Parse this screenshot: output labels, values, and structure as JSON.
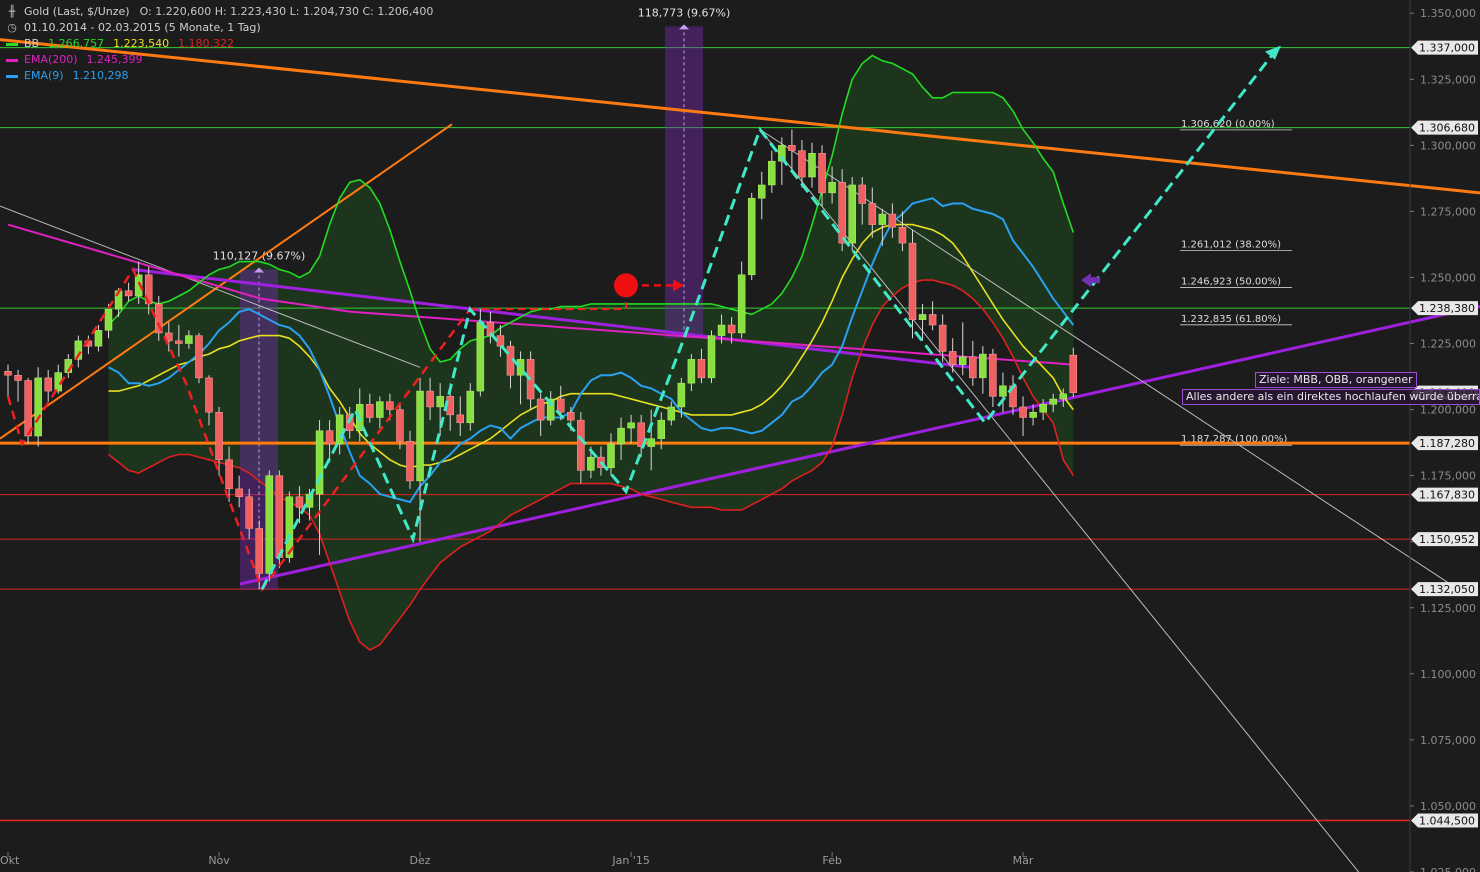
{
  "header": {
    "title": "Gold (Last, $/Unze)",
    "ohlc": "O: 1.220,600  H: 1.223,430  L: 1.204,730  C: 1.206,400",
    "range": "01.10.2014 - 02.03.2015 (5 Monate, 1 Tag)",
    "indicators": [
      {
        "name": "BB",
        "values": [
          "1.266,757",
          "1.223,540",
          "1.180,322"
        ],
        "colors": [
          "#22dd22",
          "#e8e020",
          "#e02020"
        ]
      },
      {
        "name": "EMA(200)",
        "values": [
          "1.245,399"
        ],
        "colors": [
          "#e020c0"
        ]
      },
      {
        "name": "EMA(9)",
        "values": [
          "1.210,298"
        ],
        "colors": [
          "#2aa0f0"
        ]
      }
    ]
  },
  "annotations": {
    "target_note": "Ziele: MBB, OBB, orangener",
    "warning_note": "Alles andere als ein direktes hochlaufen würde überra",
    "range_label_1": "110,127 (9.67%)",
    "range_label_2": "118,773 (9.67%)"
  },
  "chart_data": {
    "type": "candlestick",
    "title": "Gold (Last, $/Unze)",
    "x_axis": {
      "ticks": [
        "Okt",
        "Nov",
        "Dez",
        "Jan '15",
        "Feb",
        "Mär"
      ]
    },
    "y_axis": {
      "min": 1025,
      "max": 1355,
      "ticks": [
        1025,
        1050,
        1075,
        1100,
        1125,
        1150,
        1175,
        1200,
        1225,
        1250,
        1275,
        1300,
        1325,
        1350
      ],
      "tick_labels": [
        "1.025,000",
        "1.050,000",
        "1.075,000",
        "1.100,000",
        "1.125,000",
        "1.150,000",
        "1.175,000",
        "1.200,000",
        "1.225,000",
        "1.250,000",
        "1.275,000",
        "1.300,000",
        "1.325,000",
        "1.350,000"
      ]
    },
    "bars": [
      [
        1214.5,
        1217,
        1205,
        1213
      ],
      [
        1213,
        1215,
        1203,
        1211
      ],
      [
        1211,
        1212,
        1187,
        1190
      ],
      [
        1190,
        1216,
        1186,
        1212
      ],
      [
        1212,
        1215,
        1203,
        1207
      ],
      [
        1207,
        1217,
        1206,
        1214
      ],
      [
        1214,
        1221,
        1212,
        1219
      ],
      [
        1219,
        1228,
        1216,
        1226
      ],
      [
        1226,
        1228,
        1221,
        1224
      ],
      [
        1224,
        1232,
        1222,
        1230
      ],
      [
        1230,
        1240,
        1227,
        1238
      ],
      [
        1238,
        1246,
        1235,
        1245
      ],
      [
        1245,
        1248,
        1241,
        1243
      ],
      [
        1243,
        1256,
        1240,
        1251
      ],
      [
        1251,
        1254,
        1236,
        1240
      ],
      [
        1240,
        1243,
        1226,
        1229
      ],
      [
        1229,
        1233,
        1222,
        1226
      ],
      [
        1226,
        1232,
        1220,
        1225
      ],
      [
        1225,
        1230,
        1223,
        1228
      ],
      [
        1228,
        1229,
        1210,
        1212
      ],
      [
        1212,
        1213,
        1194,
        1199
      ],
      [
        1199,
        1201,
        1175,
        1181
      ],
      [
        1181,
        1186,
        1165,
        1170
      ],
      [
        1170,
        1175,
        1163,
        1167
      ],
      [
        1167,
        1170,
        1151,
        1155
      ],
      [
        1155,
        1158,
        1132,
        1138
      ],
      [
        1138,
        1177,
        1135,
        1175
      ],
      [
        1175,
        1177,
        1140,
        1144
      ],
      [
        1144,
        1169,
        1142,
        1167
      ],
      [
        1167,
        1171,
        1157,
        1163
      ],
      [
        1163,
        1170,
        1158,
        1168
      ],
      [
        1168,
        1196,
        1145,
        1192
      ],
      [
        1192,
        1196,
        1180,
        1187
      ],
      [
        1187,
        1201,
        1183,
        1198
      ],
      [
        1198,
        1201,
        1189,
        1192
      ],
      [
        1192,
        1208,
        1188,
        1202
      ],
      [
        1202,
        1206,
        1195,
        1197
      ],
      [
        1197,
        1205,
        1193,
        1203
      ],
      [
        1203,
        1206,
        1196,
        1200
      ],
      [
        1200,
        1202,
        1185,
        1188
      ],
      [
        1188,
        1192,
        1170,
        1173
      ],
      [
        1173,
        1212,
        1150,
        1207
      ],
      [
        1207,
        1212,
        1196,
        1201
      ],
      [
        1201,
        1210,
        1190,
        1205
      ],
      [
        1205,
        1210,
        1192,
        1198
      ],
      [
        1198,
        1205,
        1190,
        1195
      ],
      [
        1195,
        1210,
        1192,
        1207
      ],
      [
        1207,
        1238,
        1205,
        1233
      ],
      [
        1233,
        1237,
        1225,
        1228
      ],
      [
        1228,
        1232,
        1220,
        1224
      ],
      [
        1224,
        1226,
        1208,
        1213
      ],
      [
        1213,
        1222,
        1202,
        1219
      ],
      [
        1219,
        1222,
        1200,
        1204
      ],
      [
        1204,
        1206,
        1190,
        1196
      ],
      [
        1196,
        1207,
        1194,
        1204
      ],
      [
        1204,
        1209,
        1196,
        1199
      ],
      [
        1199,
        1201,
        1192,
        1196
      ],
      [
        1196,
        1199,
        1172,
        1177
      ],
      [
        1177,
        1186,
        1174,
        1182
      ],
      [
        1182,
        1186,
        1175,
        1178
      ],
      [
        1178,
        1191,
        1175,
        1187
      ],
      [
        1187,
        1197,
        1181,
        1193
      ],
      [
        1193,
        1198,
        1187,
        1195
      ],
      [
        1195,
        1198,
        1182,
        1186
      ],
      [
        1186,
        1200,
        1177,
        1189
      ],
      [
        1189,
        1199,
        1185,
        1196
      ],
      [
        1196,
        1203,
        1194,
        1201
      ],
      [
        1201,
        1212,
        1197,
        1210
      ],
      [
        1210,
        1221,
        1207,
        1219
      ],
      [
        1219,
        1223,
        1210,
        1212
      ],
      [
        1212,
        1230,
        1210,
        1228
      ],
      [
        1228,
        1236,
        1225,
        1232
      ],
      [
        1232,
        1235,
        1225,
        1229
      ],
      [
        1229,
        1256,
        1227,
        1251
      ],
      [
        1251,
        1282,
        1249,
        1280
      ],
      [
        1280,
        1290,
        1272,
        1285
      ],
      [
        1285,
        1298,
        1282,
        1294
      ],
      [
        1294,
        1303,
        1285,
        1300
      ],
      [
        1300,
        1306,
        1291,
        1298
      ],
      [
        1298,
        1302,
        1284,
        1288
      ],
      [
        1288,
        1301,
        1284,
        1297
      ],
      [
        1297,
        1300,
        1277,
        1282
      ],
      [
        1282,
        1292,
        1278,
        1286
      ],
      [
        1286,
        1291,
        1260,
        1263
      ],
      [
        1263,
        1288,
        1260,
        1285
      ],
      [
        1285,
        1288,
        1270,
        1278
      ],
      [
        1278,
        1284,
        1265,
        1270
      ],
      [
        1270,
        1276,
        1262,
        1274
      ],
      [
        1274,
        1278,
        1265,
        1269
      ],
      [
        1269,
        1275,
        1260,
        1263
      ],
      [
        1263,
        1268,
        1227,
        1234
      ],
      [
        1234,
        1240,
        1226,
        1236
      ],
      [
        1236,
        1241,
        1230,
        1232
      ],
      [
        1232,
        1236,
        1218,
        1222
      ],
      [
        1222,
        1227,
        1214,
        1217
      ],
      [
        1217,
        1233,
        1213,
        1220
      ],
      [
        1220,
        1226,
        1209,
        1212
      ],
      [
        1212,
        1224,
        1206,
        1221
      ],
      [
        1221,
        1223,
        1201,
        1205
      ],
      [
        1205,
        1214,
        1199,
        1209
      ],
      [
        1209,
        1213,
        1198,
        1201
      ],
      [
        1201,
        1205,
        1190,
        1197
      ],
      [
        1197,
        1202,
        1194,
        1199
      ],
      [
        1199,
        1204,
        1196,
        1202
      ],
      [
        1202,
        1206,
        1199,
        1204
      ],
      [
        1204,
        1208,
        1201,
        1206
      ],
      [
        1220.6,
        1223.43,
        1204.73,
        1206.4
      ]
    ],
    "bollinger": {
      "upper": [
        1232,
        1236,
        1241,
        1243,
        1241,
        1240,
        1241,
        1243,
        1245,
        1248,
        1251,
        1253,
        1254,
        1256,
        1256,
        1256,
        1255,
        1253,
        1252,
        1250,
        1252,
        1258,
        1270,
        1280,
        1286,
        1287,
        1284,
        1278,
        1268,
        1256,
        1245,
        1233,
        1223,
        1218,
        1219,
        1223,
        1226,
        1227,
        1228,
        1231,
        1233,
        1235,
        1237,
        1238,
        1238,
        1239,
        1239,
        1239,
        1240,
        1240,
        1240,
        1240,
        1240,
        1240,
        1240,
        1240,
        1240,
        1240,
        1240,
        1240,
        1240,
        1239,
        1238,
        1237,
        1236,
        1238,
        1240,
        1244,
        1250,
        1258,
        1270,
        1283,
        1296,
        1312,
        1325,
        1331,
        1334,
        1332,
        1331,
        1329,
        1327,
        1322,
        1318,
        1318,
        1320,
        1320,
        1320,
        1320,
        1320,
        1318,
        1313,
        1306,
        1301,
        1295,
        1290,
        1278,
        1267
      ],
      "middle": [
        1207,
        1207,
        1208,
        1209,
        1211,
        1213,
        1215,
        1217,
        1218,
        1220,
        1221,
        1223,
        1224,
        1226,
        1227,
        1228,
        1228,
        1228,
        1227,
        1224,
        1220,
        1215,
        1208,
        1203,
        1197,
        1191,
        1187,
        1184,
        1181,
        1179,
        1178,
        1179,
        1179,
        1180,
        1181,
        1183,
        1185,
        1187,
        1189,
        1192,
        1195,
        1198,
        1200,
        1202,
        1203,
        1205,
        1206,
        1206,
        1206,
        1206,
        1206,
        1205,
        1204,
        1203,
        1202,
        1201,
        1200,
        1199,
        1198,
        1198,
        1198,
        1198,
        1198,
        1199,
        1200,
        1202,
        1205,
        1209,
        1214,
        1220,
        1226,
        1233,
        1241,
        1250,
        1257,
        1263,
        1267,
        1269,
        1270,
        1270,
        1270,
        1269,
        1268,
        1266,
        1263,
        1258,
        1252,
        1246,
        1240,
        1234,
        1229,
        1224,
        1220,
        1216,
        1212,
        1205,
        1200
      ],
      "lower": [
        1183,
        1180,
        1177,
        1176,
        1178,
        1180,
        1182,
        1183,
        1183,
        1182,
        1181,
        1180,
        1179,
        1178,
        1176,
        1173,
        1170,
        1167,
        1165,
        1163,
        1160,
        1153,
        1142,
        1131,
        1120,
        1112,
        1109,
        1111,
        1116,
        1121,
        1126,
        1132,
        1137,
        1142,
        1145,
        1148,
        1150,
        1152,
        1154,
        1157,
        1160,
        1162,
        1164,
        1166,
        1168,
        1170,
        1172,
        1172,
        1172,
        1172,
        1172,
        1171,
        1170,
        1168,
        1167,
        1166,
        1165,
        1164,
        1163,
        1163,
        1163,
        1162,
        1162,
        1162,
        1164,
        1166,
        1168,
        1170,
        1173,
        1175,
        1177,
        1180,
        1186,
        1198,
        1212,
        1223,
        1232,
        1239,
        1243,
        1246,
        1248,
        1249,
        1249,
        1248,
        1247,
        1245,
        1242,
        1238,
        1233,
        1227,
        1220,
        1212,
        1205,
        1200,
        1195,
        1181,
        1175
      ]
    },
    "ema200": [
      1270,
      1268,
      1266,
      1264,
      1262,
      1260,
      1258,
      1256,
      1254,
      1252,
      1250,
      1248,
      1246,
      1244,
      1242,
      1241,
      1240,
      1239,
      1238,
      1237,
      1236.5,
      1236,
      1235.5,
      1235,
      1234.5,
      1234,
      1233.5,
      1233,
      1232.5,
      1232,
      1231.5,
      1231,
      1230.5,
      1230,
      1229.5,
      1229,
      1228.5,
      1228,
      1227.5,
      1227,
      1226.5,
      1226,
      1225.5,
      1225,
      1224.5,
      1224,
      1223.5,
      1223,
      1222.5,
      1222,
      1221.5,
      1221,
      1220.5,
      1220,
      1219.5,
      1219,
      1218.5,
      1218,
      1217.5,
      1217
    ],
    "ema9": [
      1216,
      1214,
      1210,
      1210,
      1209,
      1210,
      1212,
      1215,
      1218,
      1221,
      1225,
      1230,
      1233,
      1237,
      1238,
      1236,
      1234,
      1232,
      1231,
      1228,
      1223,
      1215,
      1205,
      1194,
      1184,
      1175,
      1172,
      1168,
      1167,
      1166,
      1165,
      1171,
      1175,
      1180,
      1183,
      1187,
      1189,
      1192,
      1194,
      1193,
      1189,
      1193,
      1195,
      1197,
      1197,
      1197,
      1199,
      1206,
      1211,
      1213,
      1213,
      1214,
      1212,
      1209,
      1208,
      1206,
      1204,
      1199,
      1196,
      1193,
      1192,
      1193,
      1193,
      1192,
      1191,
      1192,
      1195,
      1198,
      1203,
      1205,
      1209,
      1214,
      1217,
      1224,
      1235,
      1245,
      1255,
      1264,
      1271,
      1274,
      1278,
      1279,
      1280,
      1277,
      1278,
      1278,
      1276,
      1275,
      1274,
      1272,
      1264,
      1259,
      1254,
      1248,
      1242,
      1237,
      1232
    ],
    "horizontal_levels": [
      {
        "value": 1337.0,
        "label": "1.337,000"
      },
      {
        "value": 1306.68,
        "label": "1.306,680"
      },
      {
        "value": 1238.38,
        "label": "1.238,380"
      },
      {
        "value": 1206.4,
        "label": "1.206,400"
      },
      {
        "value": 1187.28,
        "label": "1.187,280"
      },
      {
        "value": 1167.83,
        "label": "1.167,830"
      },
      {
        "value": 1150.952,
        "label": "1.150,952"
      },
      {
        "value": 1132.05,
        "label": "1.132,050"
      },
      {
        "value": 1044.5,
        "label": "1.044,500"
      }
    ],
    "fibonacci": [
      {
        "value": 1306.62,
        "label": "1.306,620 (0.00%)"
      },
      {
        "value": 1261.012,
        "label": "1.261,012 (38.20%)"
      },
      {
        "value": 1246.923,
        "label": "1.246,923 (50.00%)"
      },
      {
        "value": 1232.835,
        "label": "1.232,835 (61.80%)"
      },
      {
        "value": 1187.287,
        "label": "1.187,287 (100.00%)"
      }
    ],
    "ranges": [
      {
        "label": "110,127 (9.67%)",
        "low": 1132,
        "high": 1253
      },
      {
        "label": "118,773 (9.67%)",
        "low": 1227,
        "high": 1345
      }
    ]
  }
}
